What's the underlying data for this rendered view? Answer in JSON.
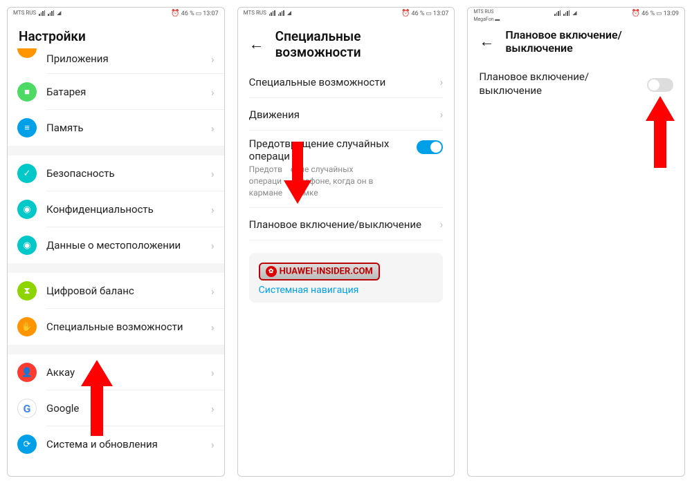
{
  "status": {
    "carrier": "MTS RUS",
    "carrier2_line1": "MTS RUS",
    "carrier2_line2": "MegaFon",
    "battery_pct": "46 %",
    "time1": "13:07",
    "time2": "13:07",
    "time3": "13:09"
  },
  "screen1": {
    "title": "Настройки",
    "items": {
      "apps": "Приложения",
      "battery": "Батарея",
      "memory": "Память",
      "security": "Безопасность",
      "privacy": "Конфиденциальность",
      "location": "Данные о местоположении",
      "digital": "Цифровой баланс",
      "accessibility": "Специальные возможности",
      "account": "Аккау",
      "google": "Google",
      "system": "Система и обновления"
    }
  },
  "screen2": {
    "title": "Специальные возможности",
    "rows": {
      "accessibility": "Специальные возможности",
      "motions": "Движения",
      "prevent_title_a": "Предотвращение случайных",
      "prevent_title_b": "операци",
      "prevent_sub_a": "Предотв",
      "prevent_sub_b": "ение случайных",
      "prevent_sub_c": "операци",
      "prevent_sub_d": "телефоне, когда он в",
      "prevent_sub_e": "кармане",
      "prevent_sub_f": "сумке",
      "schedule": "Плановое включение/выключение",
      "watermark": "HUAWEI-INSIDER.COM",
      "navlink": "Системная навигация"
    }
  },
  "screen3": {
    "title": "Плановое включение/выключение",
    "label": "Плановое включение/выключение"
  },
  "icon_glyphs": {
    "apps": "▦",
    "battery": "■",
    "memory": "≡",
    "security": "✓",
    "privacy": "◉",
    "location": "◉",
    "digital": "⧗",
    "accessibility": "✋",
    "account": "👤",
    "system": "⟳"
  }
}
